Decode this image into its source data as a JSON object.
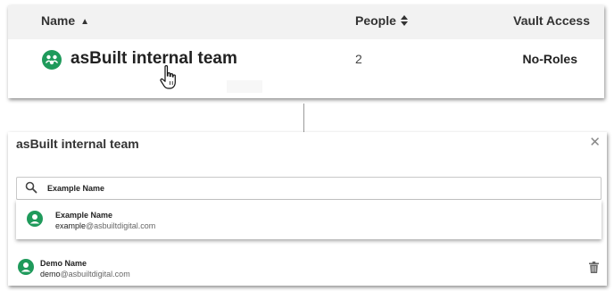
{
  "table": {
    "columns": {
      "name": "Name",
      "people": "People",
      "vault_access": "Vault Access"
    },
    "row": {
      "team_name": "asBuilt internal team",
      "people": "2",
      "vault_access": "No-Roles"
    }
  },
  "dialog": {
    "title": "asBuilt internal team",
    "search": {
      "value": "Example Name"
    },
    "suggestion": {
      "name": "Example Name",
      "email_user": "example",
      "email_domain": "@asbuiltdigital.com"
    },
    "member": {
      "name": "Demo Name",
      "email_user": "demo",
      "email_domain": "@asbuiltdigital.com"
    }
  },
  "colors": {
    "accent_green": "#1f9a5b",
    "header_bg": "#f2f2f2"
  }
}
